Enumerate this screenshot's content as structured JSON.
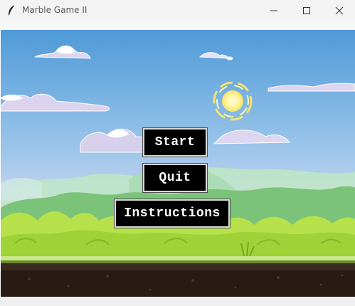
{
  "window": {
    "title": "Marble Game II",
    "icon": "feather-icon",
    "controls": [
      "minimize-icon",
      "maximize-icon",
      "close-icon"
    ]
  },
  "menu": {
    "start_label": "Start",
    "quit_label": "Quit",
    "instructions_label": "Instructions"
  },
  "colors": {
    "sky": "#6fb0e0",
    "grass": "#b6e14a",
    "soil": "#2a1a14",
    "button_bg": "#000000",
    "button_text": "#ffffff"
  }
}
